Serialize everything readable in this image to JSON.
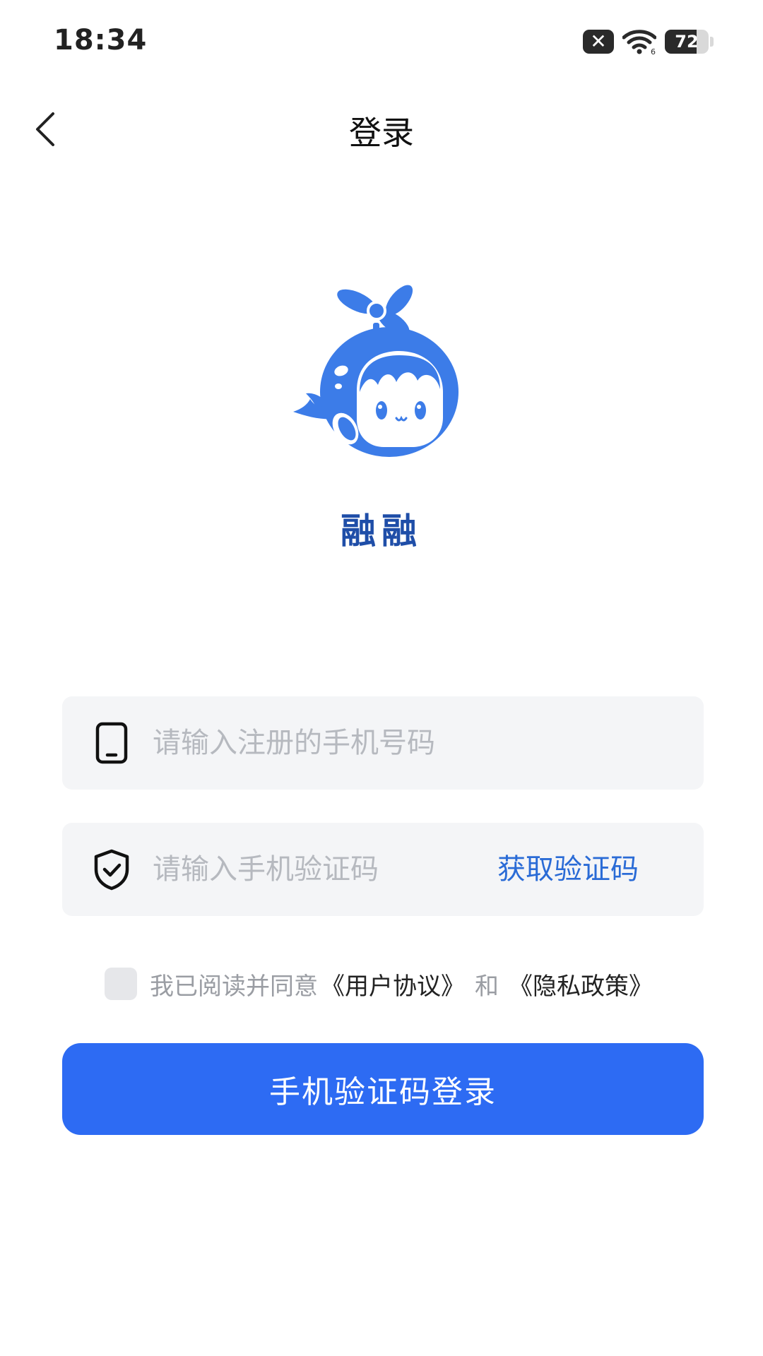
{
  "status_bar": {
    "time": "18:34",
    "battery_level": "72",
    "battery_fraction": 0.72
  },
  "nav": {
    "title": "登录"
  },
  "app": {
    "name": "融融",
    "logo_color": "#3c7ce8"
  },
  "form": {
    "phone_placeholder": "请输入注册的手机号码",
    "phone_value": "",
    "code_placeholder": "请输入手机验证码",
    "code_value": "",
    "get_code_label": "获取验证码"
  },
  "agreement": {
    "text": "我已阅读并同意",
    "user_agreement": "《用户协议》",
    "and": "和",
    "privacy_policy": "《隐私政策》",
    "checked": false
  },
  "login_button": {
    "label": "手机验证码登录",
    "color": "#2d6bf3"
  },
  "icons": {
    "back": "chevron-left-icon",
    "phone": "phone-icon",
    "shield": "shield-check-icon",
    "wifi": "wifi-icon",
    "no_signal": "no-signal-icon",
    "battery": "battery-icon"
  }
}
